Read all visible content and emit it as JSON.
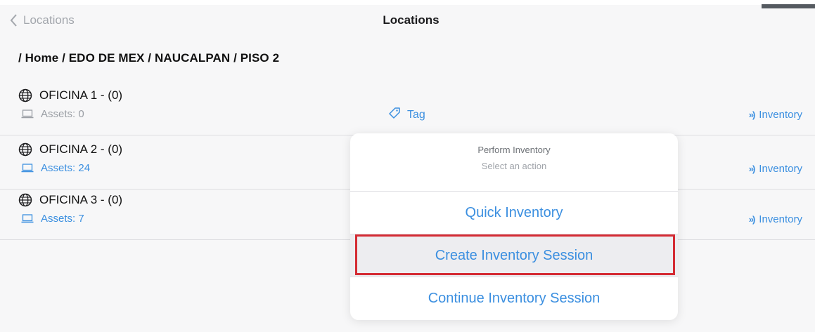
{
  "nav": {
    "back_label": "Locations",
    "title": "Locations"
  },
  "breadcrumb": "/ Home / EDO DE  MEX / NAUCALPAN / PISO 2",
  "locations": [
    {
      "name": "OFICINA 1 - (0)",
      "assets": "Assets: 0",
      "tag": "Tag",
      "inventory": "Inventory"
    },
    {
      "name": "OFICINA 2 - (0)",
      "assets": "Assets: 24",
      "inventory": "Inventory"
    },
    {
      "name": "OFICINA 3 - (0)",
      "assets": "Assets: 7",
      "inventory": "Inventory"
    }
  ],
  "popover": {
    "title": "Perform Inventory",
    "subtitle": "Select an action",
    "actions": [
      "Quick Inventory",
      "Create Inventory Session",
      "Continue Inventory Session"
    ]
  },
  "icons": {
    "back": "chevron-left-icon",
    "location": "globe-icon",
    "assets": "laptop-icon",
    "tag": "tag-icon",
    "inventory": "rfid-waves-icon"
  },
  "colors": {
    "accent": "#3b8fe0",
    "highlight_outline": "#d42b33",
    "muted": "#9a9ea4"
  }
}
